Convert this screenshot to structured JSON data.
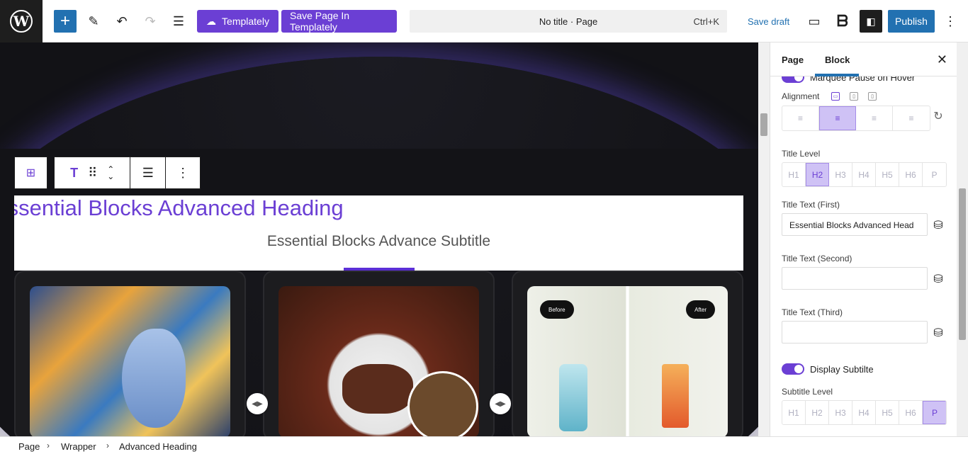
{
  "topbar": {
    "templately_label": "Templately",
    "save_in_templately_label": "Save Page In Templately",
    "command_title": "No title · Page",
    "command_shortcut": "Ctrl+K",
    "save_draft_label": "Save draft",
    "publish_label": "Publish"
  },
  "canvas": {
    "heading_text": "Essential Blocks Advanced Heading",
    "subtitle_text": "Essential Blocks Advance Subtitle",
    "before_label": "Before",
    "after_label": "After"
  },
  "panel": {
    "tab_page": "Page",
    "tab_block": "Block",
    "marquee_pause_label": "Marquee Pause on Hover",
    "alignment_label": "Alignment",
    "title_level_label": "Title Level",
    "title_levels": [
      "H1",
      "H2",
      "H3",
      "H4",
      "H5",
      "H6",
      "P"
    ],
    "title_level_selected": "H2",
    "title_text_first_label": "Title Text (First)",
    "title_text_first_value": "Essential Blocks Advanced Head",
    "title_text_second_label": "Title Text (Second)",
    "title_text_second_value": "",
    "title_text_third_label": "Title Text (Third)",
    "title_text_third_value": "",
    "display_subtitle_label": "Display Subtilte",
    "subtitle_level_label": "Subtitle Level",
    "subtitle_level_selected": "P"
  },
  "breadcrumb": [
    "Page",
    "Wrapper",
    "Advanced Heading"
  ],
  "colors": {
    "accent": "#6b3fd4",
    "wp_blue": "#2271b1"
  }
}
